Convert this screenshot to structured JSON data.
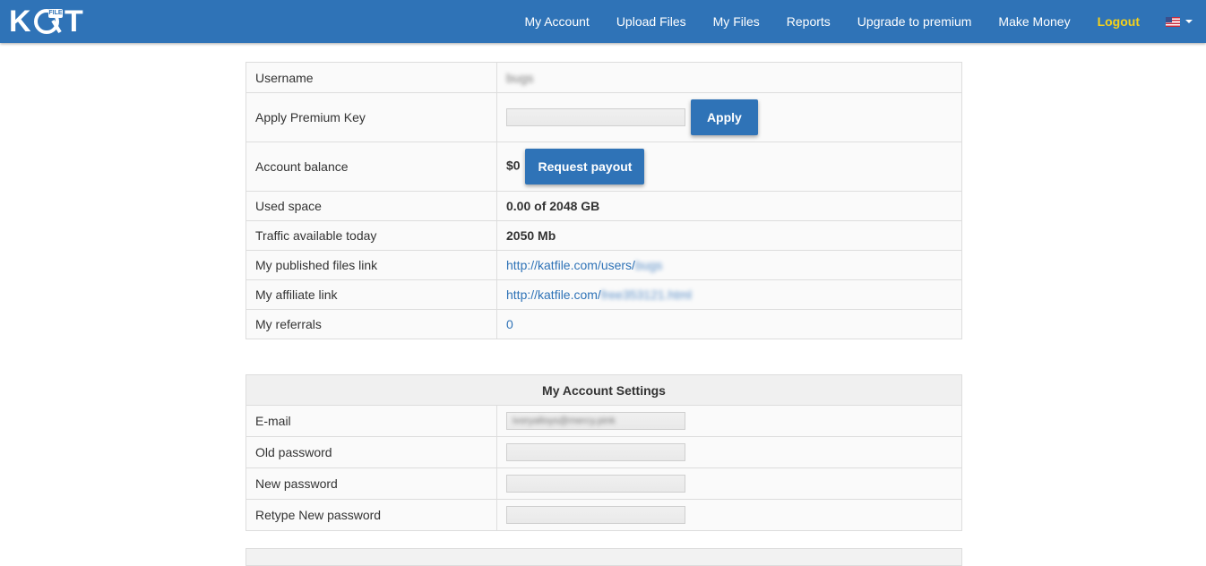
{
  "nav": {
    "logo_text_k": "K",
    "logo_text_t": "T",
    "logo_badge": "FILE",
    "items": [
      "My Account",
      "Upload Files",
      "My Files",
      "Reports",
      "Upgrade to premium",
      "Make Money"
    ],
    "logout": "Logout",
    "language_icon": "us-flag-icon"
  },
  "account": {
    "username_label": "Username",
    "username_value": "bugs",
    "premium_key_label": "Apply Premium Key",
    "premium_key_value": "",
    "apply_button": "Apply",
    "balance_label": "Account balance",
    "balance_value": "$0",
    "payout_button": "Request payout",
    "used_space_label": "Used space",
    "used_space_value": "0.00 of 2048 GB",
    "traffic_label": "Traffic available today",
    "traffic_value": "2050 Mb",
    "published_label": "My published files link",
    "published_link_prefix": "http://katfile.com/users/",
    "published_link_hidden": "bugs",
    "affiliate_label": "My affiliate link",
    "affiliate_link_prefix": "http://katfile.com/",
    "affiliate_link_hidden": "free353121.html",
    "referrals_label": "My referrals",
    "referrals_value": "0"
  },
  "settings": {
    "title": "My Account Settings",
    "email_label": "E-mail",
    "email_value": "ivoryalloys@mercy.pink",
    "old_password_label": "Old password",
    "new_password_label": "New password",
    "retype_password_label": "Retype New password"
  },
  "colors": {
    "navbar": "#2f73b7",
    "logout": "#f5d11a",
    "button": "#2f73b7",
    "link": "#2f73b7"
  }
}
